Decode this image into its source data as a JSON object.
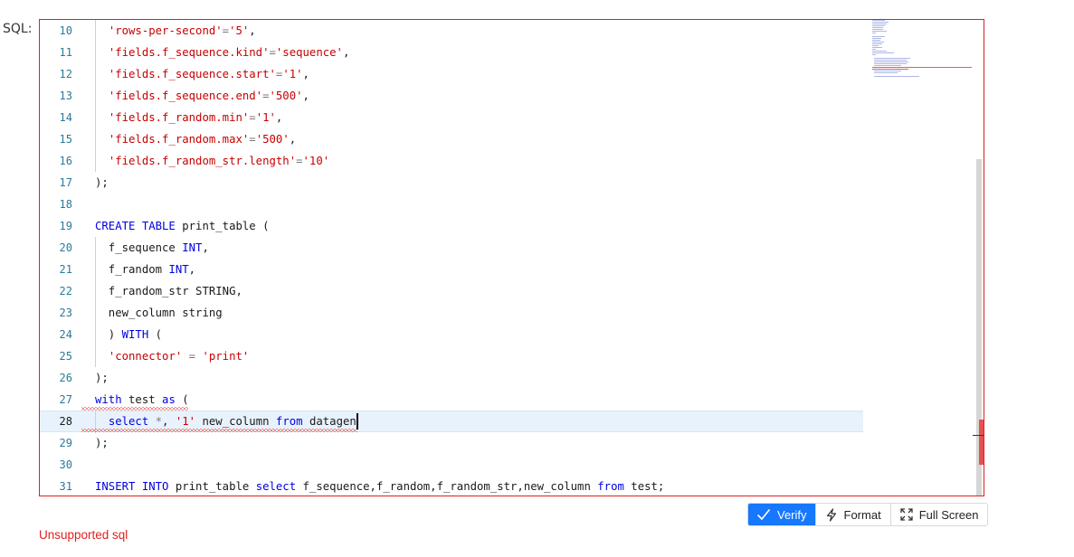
{
  "field_label": "SQL:",
  "editor": {
    "lines": [
      {
        "num": "10",
        "tokens": [
          {
            "t": "  ",
            "c": ""
          },
          {
            "t": "'rows-per-second'",
            "c": "str"
          },
          {
            "t": "=",
            "c": "op"
          },
          {
            "t": "'5'",
            "c": "str"
          },
          {
            "t": ",",
            "c": ""
          }
        ],
        "guide": true
      },
      {
        "num": "11",
        "tokens": [
          {
            "t": "  ",
            "c": ""
          },
          {
            "t": "'fields.f_sequence.kind'",
            "c": "str"
          },
          {
            "t": "=",
            "c": "op"
          },
          {
            "t": "'sequence'",
            "c": "str"
          },
          {
            "t": ",",
            "c": ""
          }
        ],
        "guide": true
      },
      {
        "num": "12",
        "tokens": [
          {
            "t": "  ",
            "c": ""
          },
          {
            "t": "'fields.f_sequence.start'",
            "c": "str"
          },
          {
            "t": "=",
            "c": "op"
          },
          {
            "t": "'1'",
            "c": "str"
          },
          {
            "t": ",",
            "c": ""
          }
        ],
        "guide": true
      },
      {
        "num": "13",
        "tokens": [
          {
            "t": "  ",
            "c": ""
          },
          {
            "t": "'fields.f_sequence.end'",
            "c": "str"
          },
          {
            "t": "=",
            "c": "op"
          },
          {
            "t": "'500'",
            "c": "str"
          },
          {
            "t": ",",
            "c": ""
          }
        ],
        "guide": true
      },
      {
        "num": "14",
        "tokens": [
          {
            "t": "  ",
            "c": ""
          },
          {
            "t": "'fields.f_random.min'",
            "c": "str"
          },
          {
            "t": "=",
            "c": "op"
          },
          {
            "t": "'1'",
            "c": "str"
          },
          {
            "t": ",",
            "c": ""
          }
        ],
        "guide": true
      },
      {
        "num": "15",
        "tokens": [
          {
            "t": "  ",
            "c": ""
          },
          {
            "t": "'fields.f_random.max'",
            "c": "str"
          },
          {
            "t": "=",
            "c": "op"
          },
          {
            "t": "'500'",
            "c": "str"
          },
          {
            "t": ",",
            "c": ""
          }
        ],
        "guide": true
      },
      {
        "num": "16",
        "tokens": [
          {
            "t": "  ",
            "c": ""
          },
          {
            "t": "'fields.f_random_str.length'",
            "c": "str"
          },
          {
            "t": "=",
            "c": "op"
          },
          {
            "t": "'10'",
            "c": "str"
          }
        ],
        "guide": true
      },
      {
        "num": "17",
        "tokens": [
          {
            "t": ");",
            "c": ""
          }
        ],
        "guide": false
      },
      {
        "num": "18",
        "tokens": [],
        "guide": false
      },
      {
        "num": "19",
        "tokens": [
          {
            "t": "CREATE TABLE",
            "c": "kw"
          },
          {
            "t": " print_table (",
            "c": ""
          }
        ],
        "guide": false
      },
      {
        "num": "20",
        "tokens": [
          {
            "t": "  f_sequence ",
            "c": ""
          },
          {
            "t": "INT",
            "c": "kw"
          },
          {
            "t": ",",
            "c": ""
          }
        ],
        "guide": true
      },
      {
        "num": "21",
        "tokens": [
          {
            "t": "  f_random ",
            "c": ""
          },
          {
            "t": "INT",
            "c": "kw"
          },
          {
            "t": ",",
            "c": ""
          }
        ],
        "guide": true
      },
      {
        "num": "22",
        "tokens": [
          {
            "t": "  f_random_str STRING,",
            "c": ""
          }
        ],
        "guide": true
      },
      {
        "num": "23",
        "tokens": [
          {
            "t": "  new_column string",
            "c": ""
          }
        ],
        "guide": true
      },
      {
        "num": "24",
        "tokens": [
          {
            "t": "  ) ",
            "c": ""
          },
          {
            "t": "WITH",
            "c": "kw"
          },
          {
            "t": " (",
            "c": ""
          }
        ],
        "guide": true
      },
      {
        "num": "25",
        "tokens": [
          {
            "t": "  ",
            "c": ""
          },
          {
            "t": "'connector'",
            "c": "str"
          },
          {
            "t": " = ",
            "c": "op"
          },
          {
            "t": "'print'",
            "c": "str"
          }
        ],
        "guide": true
      },
      {
        "num": "26",
        "tokens": [
          {
            "t": ");",
            "c": ""
          }
        ],
        "guide": false
      },
      {
        "num": "27",
        "tokens": [
          {
            "t": "with",
            "c": "kw"
          },
          {
            "t": " test ",
            "c": ""
          },
          {
            "t": "as",
            "c": "kw"
          },
          {
            "t": " (",
            "c": ""
          }
        ],
        "guide": false
      },
      {
        "num": "28",
        "tokens": [
          {
            "t": "  ",
            "c": ""
          },
          {
            "t": "select",
            "c": "kw"
          },
          {
            "t": " ",
            "c": ""
          },
          {
            "t": "*",
            "c": "op"
          },
          {
            "t": ", ",
            "c": ""
          },
          {
            "t": "'1'",
            "c": "str"
          },
          {
            "t": " new_column ",
            "c": ""
          },
          {
            "t": "from",
            "c": "kw"
          },
          {
            "t": " datagen",
            "c": ""
          }
        ],
        "guide": true,
        "active": true
      },
      {
        "num": "29",
        "tokens": [
          {
            "t": ");",
            "c": ""
          }
        ],
        "guide": false
      },
      {
        "num": "30",
        "tokens": [],
        "guide": false
      },
      {
        "num": "31",
        "tokens": [
          {
            "t": "INSERT INTO",
            "c": "kw"
          },
          {
            "t": " print_table ",
            "c": ""
          },
          {
            "t": "select",
            "c": "kw"
          },
          {
            "t": " f_sequence,f_random,f_random_str,new_column ",
            "c": ""
          },
          {
            "t": "from",
            "c": "kw"
          },
          {
            "t": " test;",
            "c": ""
          }
        ],
        "guide": false
      }
    ]
  },
  "toolbar": {
    "verify_label": "Verify",
    "format_label": "Format",
    "fullscreen_label": "Full Screen"
  },
  "error_message": "Unsupported sql",
  "colors": {
    "accent": "#1677ff",
    "error": "#e02020",
    "keyword": "#0000e0",
    "string": "#c80000",
    "line_number": "#2a7a9a",
    "active_line_bg": "#e8f2fc"
  },
  "icons": {
    "verify": "check-icon",
    "format": "lightning-icon",
    "fullscreen": "expand-icon"
  }
}
